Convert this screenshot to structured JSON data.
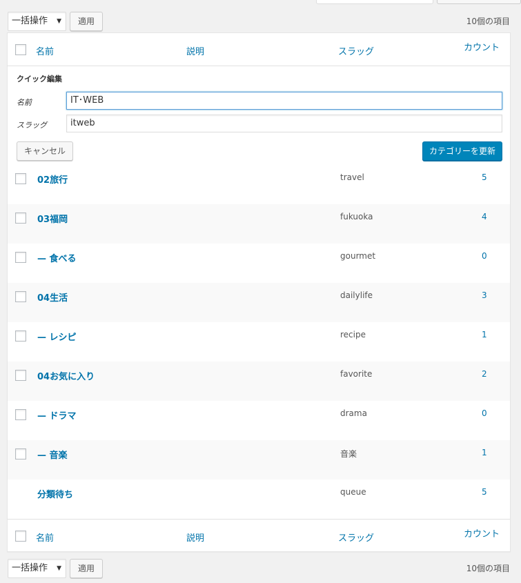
{
  "bulk_actions": {
    "label": "一括操作",
    "apply": "適用",
    "item_count": "10個の項目"
  },
  "columns": {
    "name": "名前",
    "description": "説明",
    "slug": "スラッグ",
    "count": "カウント"
  },
  "quick_edit": {
    "title": "クイック編集",
    "name_label": "名前",
    "name_value": "IT･WEB",
    "slug_label": "スラッグ",
    "slug_value": "itweb",
    "cancel": "キャンセル",
    "update": "カテゴリーを更新"
  },
  "rows": [
    {
      "name": "02旅行",
      "slug": "travel",
      "count": "5",
      "checkbox": true
    },
    {
      "name": "03福岡",
      "slug": "fukuoka",
      "count": "4",
      "checkbox": true
    },
    {
      "name": "— 食べる",
      "slug": "gourmet",
      "count": "0",
      "checkbox": true
    },
    {
      "name": "04生活",
      "slug": "dailylife",
      "count": "3",
      "checkbox": true
    },
    {
      "name": "— レシピ",
      "slug": "recipe",
      "count": "1",
      "checkbox": true
    },
    {
      "name": "04お気に入り",
      "slug": "favorite",
      "count": "2",
      "checkbox": true
    },
    {
      "name": "— ドラマ",
      "slug": "drama",
      "count": "0",
      "checkbox": true
    },
    {
      "name": "— 音楽",
      "slug": "音楽",
      "count": "1",
      "checkbox": true
    },
    {
      "name": "分類待ち",
      "slug": "queue",
      "count": "5",
      "checkbox": false
    }
  ],
  "colors": {
    "link": "#0073aa",
    "primary_button": "#0085ba"
  }
}
